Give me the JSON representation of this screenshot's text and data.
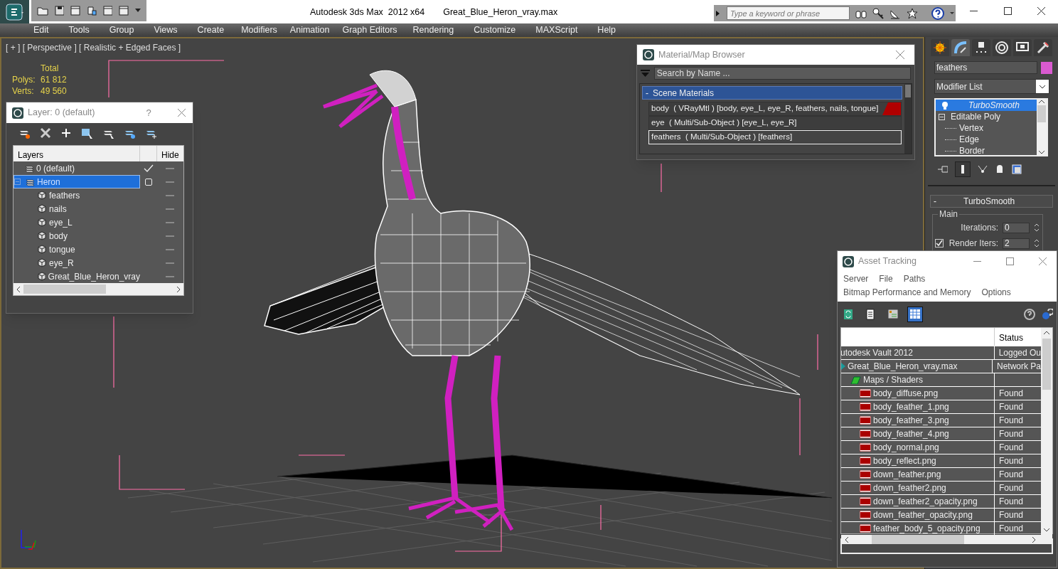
{
  "window": {
    "title": "Autodesk 3ds Max  2012 x64",
    "file": "Great_Blue_Heron_vray.max"
  },
  "search": {
    "placeholder": "Type a keyword or phrase"
  },
  "menu": [
    "Edit",
    "Tools",
    "Group",
    "Views",
    "Create",
    "Modifiers",
    "Animation",
    "Graph Editors",
    "Rendering",
    "Customize",
    "MAXScript",
    "Help"
  ],
  "viewport": {
    "label": "[ + ] [ Perspective ] [ Realistic + Edged Faces ]",
    "stats_heading": "Total",
    "stats": [
      {
        "label": "Polys:",
        "value": "61 812"
      },
      {
        "label": "Verts:",
        "value": "49 560"
      }
    ]
  },
  "layer_window": {
    "title": "Layer: 0 (default)",
    "help": "?",
    "columns": [
      "Layers",
      "Hide"
    ],
    "layers": [
      {
        "name": "0 (default)",
        "current": true,
        "selected": false
      },
      {
        "name": "Heron",
        "current": false,
        "selected": true,
        "children": [
          {
            "name": "feathers"
          },
          {
            "name": "nails"
          },
          {
            "name": "eye_L"
          },
          {
            "name": "body"
          },
          {
            "name": "tongue"
          },
          {
            "name": "eye_R"
          },
          {
            "name": "Great_Blue_Heron_vray"
          }
        ]
      }
    ]
  },
  "material_browser": {
    "title": "Material/Map Browser",
    "search_placeholder": "Search by Name ...",
    "group": "Scene Materials",
    "group_toggle": "-",
    "materials": [
      {
        "text": "body  ( VRayMtl ) [body, eye_L, eye_R, feathers, nails, tongue]",
        "flagged": true,
        "selected": false
      },
      {
        "text": "eye  ( Multi/Sub-Object ) [eye_L, eye_R]",
        "flagged": false,
        "selected": false
      },
      {
        "text": "feathers  ( Multi/Sub-Object ) [feathers]",
        "flagged": false,
        "selected": true
      }
    ]
  },
  "command_panel": {
    "tabs": [
      {
        "kind": "create",
        "selected": false
      },
      {
        "kind": "modify",
        "selected": true
      },
      {
        "kind": "hierarchy",
        "selected": false
      },
      {
        "kind": "motion",
        "selected": false
      },
      {
        "kind": "display",
        "selected": false
      },
      {
        "kind": "utilities",
        "selected": false
      }
    ],
    "object_name": "feathers",
    "modifier_list": "Modifier List",
    "stack": [
      {
        "name": "TurboSmooth",
        "selected": true
      },
      {
        "name": "Editable Poly",
        "selected": false,
        "children": [
          {
            "name": "Vertex",
            "selected": false
          },
          {
            "name": "Edge",
            "selected": false
          },
          {
            "name": "Border",
            "selected": false
          }
        ]
      }
    ],
    "rollout": {
      "title": "TurboSmooth",
      "collapse": "-",
      "group": "Main",
      "iterations": {
        "label": "Iterations:",
        "value": "0"
      },
      "render_iters": {
        "label": "Render Iters:",
        "value": "2",
        "checked": true
      }
    }
  },
  "asset_tracking": {
    "title": "Asset Tracking",
    "menu": [
      [
        "Server",
        "File",
        "Paths"
      ],
      [
        "Bitmap Performance and Memory",
        "Options"
      ]
    ],
    "toolbar": [
      {
        "kind": "refresh",
        "selected": false
      },
      {
        "kind": "list",
        "selected": false
      },
      {
        "kind": "tree",
        "selected": false
      },
      {
        "kind": "table",
        "selected": true
      }
    ],
    "status_column": "Status",
    "rows": [
      {
        "kind": "server",
        "name": "utodesk Vault 2012",
        "status": "Logged Ou"
      },
      {
        "kind": "file",
        "name": "Great_Blue_Heron_vray.max",
        "status": "Network Pa"
      },
      {
        "kind": "group",
        "name": "Maps / Shaders"
      },
      {
        "kind": "png",
        "name": "body_diffuse.png",
        "status": "Found"
      },
      {
        "kind": "png",
        "name": "body_feather_1.png",
        "status": "Found"
      },
      {
        "kind": "png",
        "name": "body_feather_3.png",
        "status": "Found"
      },
      {
        "kind": "png",
        "name": "body_feather_4.png",
        "status": "Found"
      },
      {
        "kind": "png",
        "name": "body_normal.png",
        "status": "Found"
      },
      {
        "kind": "png",
        "name": "body_reflect.png",
        "status": "Found"
      },
      {
        "kind": "png",
        "name": "down_feather.png",
        "status": "Found"
      },
      {
        "kind": "png",
        "name": "down_feather2.png",
        "status": "Found"
      },
      {
        "kind": "png",
        "name": "down_feather2_opacity.png",
        "status": "Found"
      },
      {
        "kind": "png",
        "name": "down_feather_opacity.png",
        "status": "Found"
      },
      {
        "kind": "png",
        "name": "feather_body_5_opacity.png",
        "status": "Found"
      }
    ]
  }
}
